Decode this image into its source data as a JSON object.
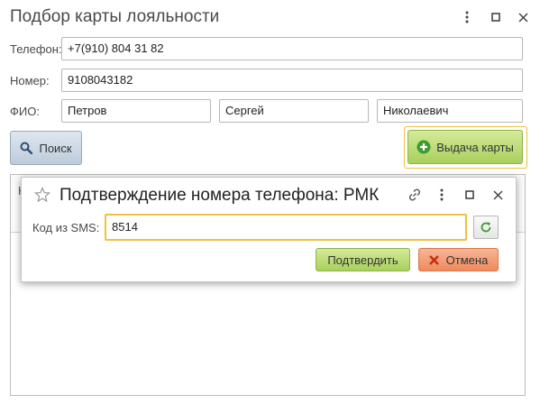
{
  "window": {
    "title": "Подбор карты лояльности",
    "menu_icon": "more-vertical-icon",
    "maximize_icon": "maximize-icon",
    "close_icon": "close-icon"
  },
  "form": {
    "phone_label": "Телефон:",
    "phone_value": "+7(910) 804 31 82",
    "number_label": "Номер:",
    "number_value": "9108043182",
    "fio_label": "ФИО:",
    "last_name": "Петров",
    "first_name": "Сергей",
    "middle_name": "Николаевич"
  },
  "buttons": {
    "search_label": "Поиск",
    "issue_card_label": "Выдача карты"
  },
  "table": {
    "header_partial": "Н"
  },
  "dialog": {
    "title": "Подтверждение номера телефона: РМК",
    "sms_label": "Код из SMS:",
    "sms_value": "8514",
    "confirm_label": "Подтвердить",
    "cancel_label": "Отмена"
  },
  "colors": {
    "accent_focus": "#f0c040",
    "green_button": "#a9cf5c",
    "cancel_button": "#ef8a5d",
    "search_button": "#bccbdb"
  }
}
